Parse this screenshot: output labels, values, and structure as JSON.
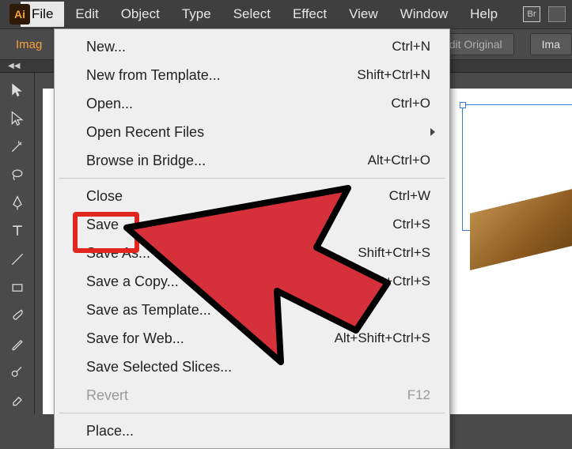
{
  "app": {
    "logo": "Ai"
  },
  "menubar": {
    "items": [
      "File",
      "Edit",
      "Object",
      "Type",
      "Select",
      "Effect",
      "View",
      "Window",
      "Help"
    ],
    "active_index": 0
  },
  "optionbar": {
    "left_label": "Imag",
    "edit_original": "Edit Original",
    "image_btn": "Ima"
  },
  "collapse_label": "◀◀",
  "dropdown": {
    "groups": [
      [
        {
          "label": "New...",
          "shortcut": "Ctrl+N",
          "enabled": true
        },
        {
          "label": "New from Template...",
          "shortcut": "Shift+Ctrl+N",
          "enabled": true
        },
        {
          "label": "Open...",
          "shortcut": "Ctrl+O",
          "enabled": true
        },
        {
          "label": "Open Recent Files",
          "shortcut": "",
          "enabled": true,
          "submenu": true
        },
        {
          "label": "Browse in Bridge...",
          "shortcut": "Alt+Ctrl+O",
          "enabled": true
        }
      ],
      [
        {
          "label": "Close",
          "shortcut": "Ctrl+W",
          "enabled": true
        },
        {
          "label": "Save",
          "shortcut": "Ctrl+S",
          "enabled": true
        },
        {
          "label": "Save As...",
          "shortcut": "Shift+Ctrl+S",
          "enabled": true
        },
        {
          "label": "Save a Copy...",
          "shortcut": "Alt+Ctrl+S",
          "enabled": true
        },
        {
          "label": "Save as Template...",
          "shortcut": "",
          "enabled": true
        },
        {
          "label": "Save for Web...",
          "shortcut": "Alt+Shift+Ctrl+S",
          "enabled": true
        },
        {
          "label": "Save Selected Slices...",
          "shortcut": "",
          "enabled": true
        },
        {
          "label": "Revert",
          "shortcut": "F12",
          "enabled": false
        }
      ],
      [
        {
          "label": "Place...",
          "shortcut": "",
          "enabled": true
        }
      ]
    ]
  },
  "tools": [
    "selection",
    "direct-selection",
    "magic-wand",
    "lasso",
    "pen",
    "type",
    "line",
    "rectangle",
    "paintbrush",
    "pencil",
    "blob-brush",
    "eraser"
  ],
  "menubar_icons": {
    "br": "Br"
  }
}
